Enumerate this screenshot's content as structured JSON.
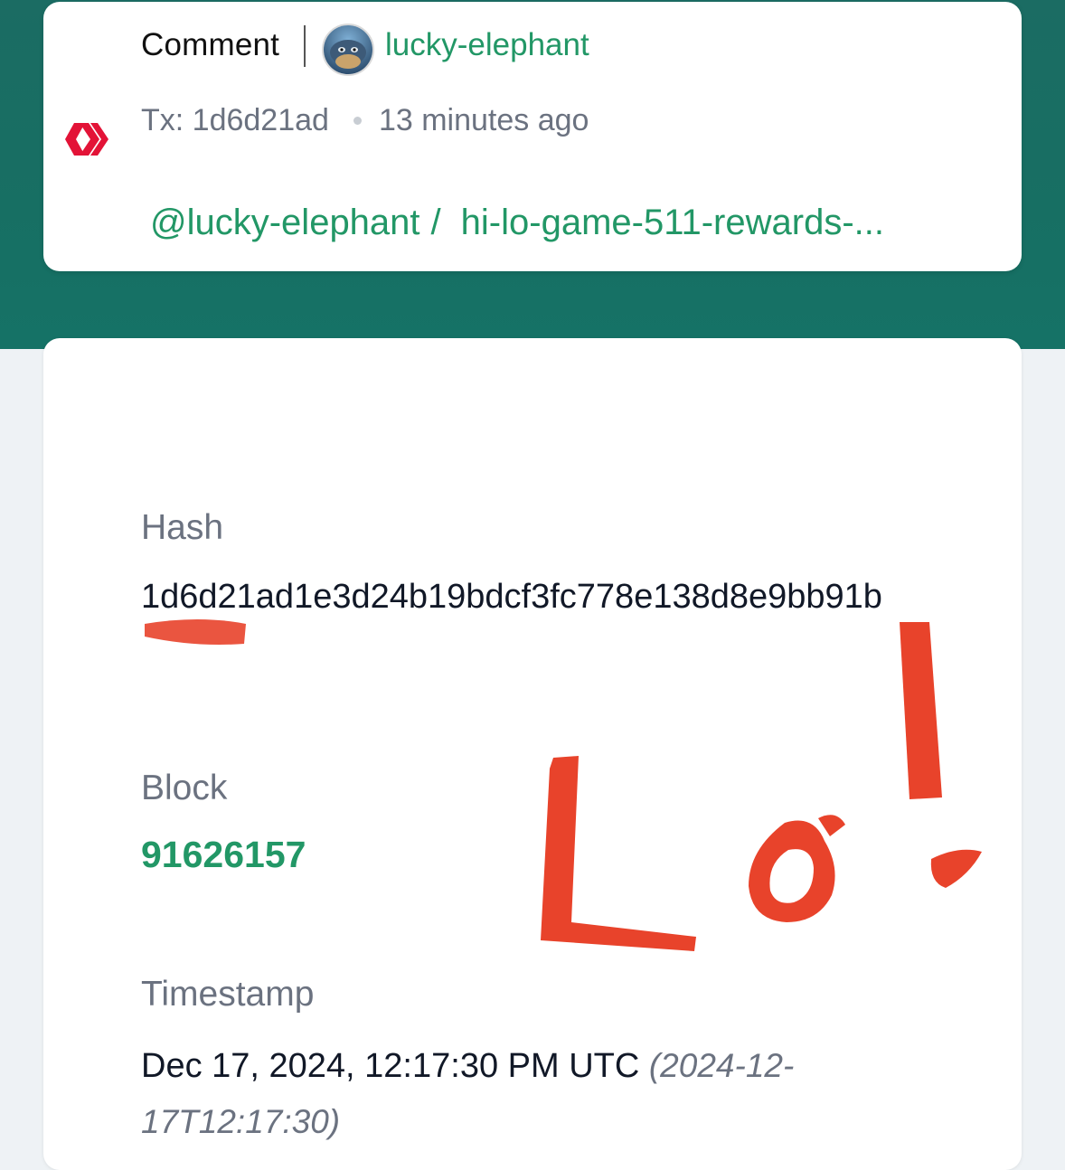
{
  "operation": {
    "type": "Comment",
    "author": "lucky-elephant",
    "tx_label": "Tx: 1d6d21ad",
    "time_ago": "13 minutes ago",
    "permlink_author": "@lucky-elephant",
    "permlink_separator": "/",
    "permlink": "hi-lo-game-511-rewards-...",
    "icon": "hive-logo-icon",
    "brand_color": "#e31337",
    "link_color": "#229766"
  },
  "details": {
    "hash_label": "Hash",
    "hash_value": "1d6d21ad1e3d24b19bdcf3fc778e138d8e9bb91b",
    "block_label": "Block",
    "block_value": "91626157",
    "timestamp_label": "Timestamp",
    "timestamp_value": "Dec 17, 2024, 12:17:30 PM UTC",
    "timestamp_iso": "(2024-12-17T12:17:30)"
  },
  "annotation": {
    "handwritten_text": "Lo!",
    "color": "#e8432b"
  }
}
